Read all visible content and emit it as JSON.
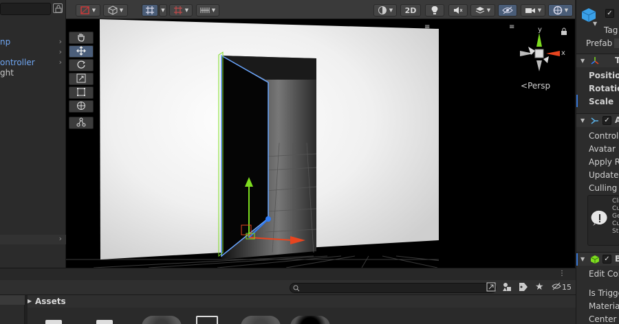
{
  "hierarchy": {
    "items": [
      {
        "label": "np",
        "color": "blue",
        "has_children": true
      },
      {
        "label": "",
        "color": "white",
        "has_children": true
      },
      {
        "label": "ontroller",
        "color": "blue",
        "has_children": true
      },
      {
        "label": "ght",
        "color": "white",
        "has_children": false
      }
    ]
  },
  "scene_toolbar": {
    "mode_2d_label": "2D",
    "icons": [
      "draw-mode-icon",
      "shading-icon",
      "grid-snap-icon",
      "increment-snap-icon",
      "ruler-icon",
      "lighting-icon",
      "audio-icon",
      "effects-icon",
      "visibility-icon",
      "camera-icon",
      "gizmos-icon"
    ]
  },
  "tool_palette": {
    "tools": [
      "hand-tool",
      "move-tool",
      "rotate-tool",
      "scale-tool",
      "rect-tool",
      "transform-tool",
      "custom-tool"
    ],
    "active_tool": "move-tool"
  },
  "scene_gizmo": {
    "projection_label": "Persp",
    "axis_y": "y",
    "axis_x": "x"
  },
  "inspector": {
    "tag_label": "Tag",
    "prefab_label": "Prefab",
    "transform": {
      "header_letter": "T",
      "position_label": "Position",
      "rotation_label": "Rotation",
      "scale_label": "Scale"
    },
    "animator": {
      "header_letter": "A",
      "controller_label": "Controlle",
      "avatar_label": "Avatar",
      "apply_root_label": "Apply Ro",
      "update_mode_label": "Update M",
      "culling_mode_label": "Culling M",
      "info_lines": [
        "Cli",
        "Cu",
        "Ge",
        "Cu",
        "St"
      ]
    },
    "box_collider": {
      "header_letter": "B",
      "edit_collider_label": "Edit Colli",
      "is_trigger_label": "Is Trigge",
      "material_label": "Material",
      "center_label": "Center"
    }
  },
  "project": {
    "assets_header": "Assets",
    "hidden_count": "15",
    "icons": [
      "search-icon",
      "add-to-scene-icon",
      "filter-type-icon",
      "filter-label-icon",
      "favorite-icon",
      "hidden-packages-icon"
    ]
  },
  "colors": {
    "accent_blue": "#4a5d78",
    "gizmo_y": "#7ddc1f",
    "gizmo_x": "#e8451f",
    "gizmo_z": "#2f7cf6",
    "selection_outline": "#6aa6ff"
  }
}
